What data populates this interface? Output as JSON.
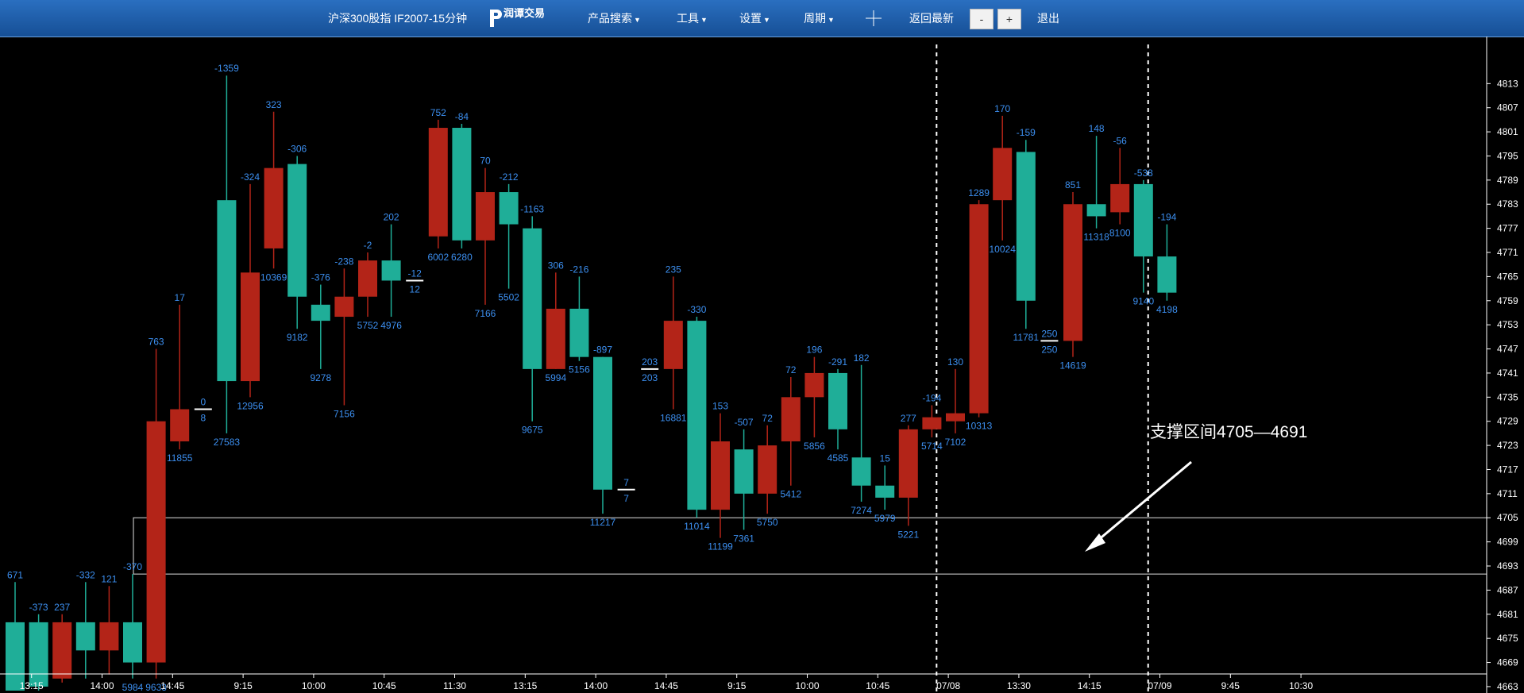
{
  "toolbar": {
    "title": "沪深300股指 IF2007-15分钟",
    "logo_text": "润谭交易",
    "product_search": "产品搜索",
    "tools": "工具",
    "settings": "设置",
    "period": "周期",
    "back_latest": "返回最新",
    "zoom_out": "-",
    "zoom_in": "+",
    "exit": "退出"
  },
  "annotation": "支撑区间4705—4691",
  "colors": {
    "up": "#b32418",
    "down": "#1fae98",
    "label": "#3c8ff0",
    "background": "#000000"
  },
  "chart_data": {
    "type": "candlestick",
    "ylim": [
      4662,
      4818
    ],
    "y_ticks": [
      4663,
      4669,
      4675,
      4681,
      4687,
      4693,
      4699,
      4705,
      4711,
      4717,
      4723,
      4729,
      4735,
      4741,
      4747,
      4753,
      4759,
      4765,
      4771,
      4777,
      4783,
      4789,
      4795,
      4801,
      4807,
      4813
    ],
    "x_ticks": [
      {
        "label": "13:15",
        "i": 0.7
      },
      {
        "label": "14:00",
        "i": 3.7
      },
      {
        "label": "14:45",
        "i": 6.7
      },
      {
        "label": "9:15",
        "i": 9.7
      },
      {
        "label": "10:00",
        "i": 12.7
      },
      {
        "label": "10:45",
        "i": 15.7
      },
      {
        "label": "11:30",
        "i": 18.7
      },
      {
        "label": "13:15",
        "i": 21.7
      },
      {
        "label": "14:00",
        "i": 24.7
      },
      {
        "label": "14:45",
        "i": 27.7
      },
      {
        "label": "9:15",
        "i": 30.7
      },
      {
        "label": "10:00",
        "i": 33.7
      },
      {
        "label": "10:45",
        "i": 36.7
      },
      {
        "label": "07/08",
        "i": 39.7
      },
      {
        "label": "13:30",
        "i": 42.7
      },
      {
        "label": "14:15",
        "i": 45.7
      },
      {
        "label": "07/09",
        "i": 48.7
      },
      {
        "label": "9:45",
        "i": 51.7
      },
      {
        "label": "10:30",
        "i": 54.7
      }
    ],
    "session_dividers": [
      39.2,
      48.2
    ],
    "support_zone": [
      4705,
      4691
    ],
    "candles": [
      {
        "o": 4679,
        "c": 4662,
        "h": 4689,
        "l": 4662,
        "top": "671",
        "bottom": ""
      },
      {
        "o": 4679,
        "c": 4663,
        "h": 4681,
        "l": 4662,
        "top": "-373",
        "bottom": ""
      },
      {
        "o": 4665,
        "c": 4679,
        "h": 4681,
        "l": 4664,
        "top": "237",
        "bottom": ""
      },
      {
        "o": 4679,
        "c": 4672,
        "h": 4689,
        "l": 4665,
        "top": "-332",
        "bottom": ""
      },
      {
        "o": 4672,
        "c": 4679,
        "h": 4688,
        "l": 4666,
        "top": "121",
        "bottom": ""
      },
      {
        "o": 4679,
        "c": 4669,
        "h": 4691,
        "l": 4665,
        "top": "-370",
        "bottom": "5984"
      },
      {
        "o": 4669,
        "c": 4729,
        "h": 4747,
        "l": 4665,
        "top": "763",
        "bottom": "9633"
      },
      {
        "o": 4724,
        "c": 4732,
        "h": 4758,
        "l": 4722,
        "top": "17",
        "bottom": "11855"
      },
      {
        "type": "doji",
        "v": 4732,
        "top": "0",
        "bottom": "8"
      },
      {
        "o": 4784,
        "c": 4739,
        "h": 4815,
        "l": 4726,
        "top": "-1359",
        "bottom": "27583"
      },
      {
        "o": 4739,
        "c": 4766,
        "h": 4788,
        "l": 4735,
        "top": "-324",
        "bottom": "12956"
      },
      {
        "o": 4772,
        "c": 4792,
        "h": 4806,
        "l": 4767,
        "top": "323",
        "bottom": "10369"
      },
      {
        "o": 4793,
        "c": 4760,
        "h": 4795,
        "l": 4752,
        "top": "-306",
        "bottom": "9182"
      },
      {
        "o": 4758,
        "c": 4754,
        "h": 4763,
        "l": 4742,
        "top": "-376",
        "bottom": "9278"
      },
      {
        "o": 4755,
        "c": 4760,
        "h": 4767,
        "l": 4733,
        "top": "-238",
        "bottom": "7156"
      },
      {
        "o": 4760,
        "c": 4769,
        "h": 4771,
        "l": 4755,
        "top": "-2",
        "bottom": "5752"
      },
      {
        "o": 4769,
        "c": 4764,
        "h": 4778,
        "l": 4755,
        "top": "202",
        "bottom": "4976"
      },
      {
        "type": "doji",
        "v": 4764,
        "top": "-12",
        "bottom": "12"
      },
      {
        "o": 4775,
        "c": 4802,
        "h": 4804,
        "l": 4772,
        "top": "752",
        "bottom": "6002"
      },
      {
        "o": 4802,
        "c": 4774,
        "h": 4803,
        "l": 4772,
        "top": "-84",
        "bottom": "6280"
      },
      {
        "o": 4774,
        "c": 4786,
        "h": 4792,
        "l": 4758,
        "top": "70",
        "bottom": "7166"
      },
      {
        "o": 4786,
        "c": 4778,
        "h": 4788,
        "l": 4762,
        "top": "-212",
        "bottom": "5502"
      },
      {
        "o": 4777,
        "c": 4742,
        "h": 4780,
        "l": 4729,
        "top": "-1163",
        "bottom": "9675"
      },
      {
        "o": 4742,
        "c": 4757,
        "h": 4766,
        "l": 4742,
        "top": "306",
        "bottom": "5994"
      },
      {
        "o": 4757,
        "c": 4745,
        "h": 4765,
        "l": 4744,
        "top": "-216",
        "bottom": "5156"
      },
      {
        "o": 4745,
        "c": 4712,
        "h": 4745,
        "l": 4706,
        "top": "-897",
        "bottom": "11217"
      },
      {
        "type": "doji",
        "v": 4712,
        "top": "7",
        "bottom": "7"
      },
      {
        "type": "doji",
        "v": 4742,
        "top": "203",
        "bottom": "203"
      },
      {
        "o": 4742,
        "c": 4754,
        "h": 4765,
        "l": 4732,
        "top": "235",
        "bottom": "16881"
      },
      {
        "o": 4754,
        "c": 4707,
        "h": 4755,
        "l": 4705,
        "top": "-330",
        "bottom": "11014"
      },
      {
        "o": 4707,
        "c": 4724,
        "h": 4731,
        "l": 4700,
        "top": "153",
        "bottom": "11199"
      },
      {
        "o": 4722,
        "c": 4711,
        "h": 4727,
        "l": 4702,
        "top": "-507",
        "bottom": "7361"
      },
      {
        "o": 4711,
        "c": 4723,
        "h": 4728,
        "l": 4706,
        "top": "72",
        "bottom": "5750"
      },
      {
        "o": 4724,
        "c": 4735,
        "h": 4740,
        "l": 4713,
        "top": "72",
        "bottom": "5412"
      },
      {
        "o": 4735,
        "c": 4741,
        "h": 4745,
        "l": 4725,
        "top": "196",
        "bottom": "5856"
      },
      {
        "o": 4741,
        "c": 4727,
        "h": 4742,
        "l": 4722,
        "top": "-291",
        "bottom": "4585"
      },
      {
        "o": 4720,
        "c": 4713,
        "h": 4743,
        "l": 4709,
        "top": "182",
        "bottom": "7274"
      },
      {
        "o": 4713,
        "c": 4710,
        "h": 4718,
        "l": 4707,
        "top": "15",
        "bottom": "5979"
      },
      {
        "o": 4710,
        "c": 4727,
        "h": 4728,
        "l": 4703,
        "top": "277",
        "bottom": "5221"
      },
      {
        "o": 4727,
        "c": 4730,
        "h": 4733,
        "l": 4725,
        "top": "-194",
        "bottom": "5714"
      },
      {
        "o": 4729,
        "c": 4731,
        "h": 4742,
        "l": 4726,
        "top": "130",
        "bottom": "7102"
      },
      {
        "o": 4731,
        "c": 4783,
        "h": 4784,
        "l": 4730,
        "top": "1289",
        "bottom": "10313"
      },
      {
        "o": 4784,
        "c": 4797,
        "h": 4805,
        "l": 4774,
        "top": "170",
        "bottom": "10024"
      },
      {
        "o": 4796,
        "c": 4759,
        "h": 4799,
        "l": 4752,
        "top": "-159",
        "bottom": "11781"
      },
      {
        "type": "doji",
        "v": 4749,
        "top": "250",
        "bottom": "250"
      },
      {
        "o": 4749,
        "c": 4783,
        "h": 4786,
        "l": 4745,
        "top": "851",
        "bottom": "14619"
      },
      {
        "o": 4783,
        "c": 4780,
        "h": 4800,
        "l": 4777,
        "top": "148",
        "bottom": "11318"
      },
      {
        "o": 4781,
        "c": 4788,
        "h": 4797,
        "l": 4778,
        "top": "-56",
        "bottom": "8100"
      },
      {
        "o": 4788,
        "c": 4770,
        "h": 4789,
        "l": 4761,
        "top": "-538",
        "bottom": "9140"
      },
      {
        "o": 4770,
        "c": 4761,
        "h": 4778,
        "l": 4759,
        "top": "-194",
        "bottom": "4198"
      }
    ]
  }
}
